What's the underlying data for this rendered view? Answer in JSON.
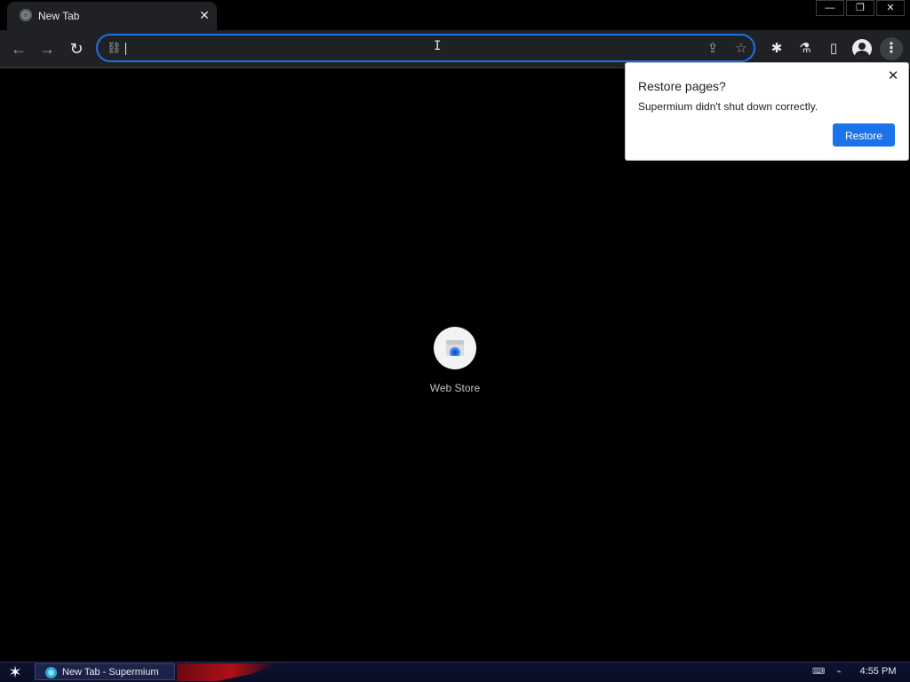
{
  "tab": {
    "title": "New Tab",
    "close_glyph": "✕",
    "favicon": "globe-icon"
  },
  "window_controls": {
    "minimize_glyph": "—",
    "restore_glyph": "❐",
    "close_glyph": "✕"
  },
  "toolbar": {
    "back_glyph": "←",
    "forward_glyph": "→",
    "reload_glyph": "↻",
    "share_glyph": "⇪",
    "bookmark_glyph": "☆",
    "extensions_glyph": "✱",
    "labs_glyph": "⚗",
    "side_panel_glyph": "▯",
    "menu_glyph": "⋮"
  },
  "omnibox": {
    "value": "",
    "placeholder": "",
    "site_info_glyph": "⛓"
  },
  "restore_popup": {
    "title": "Restore pages?",
    "message": "Supermium didn't shut down correctly.",
    "button_label": "Restore",
    "close_glyph": "✕"
  },
  "shortcuts": [
    {
      "label": "Web Store",
      "icon": "web-store-icon"
    }
  ],
  "taskbar": {
    "start_glyph": "✶",
    "task_label": "New Tab - Supermium",
    "keyboard_glyph": "⌨",
    "network_glyph": "⌁",
    "clock": "4:55 PM"
  },
  "colors": {
    "accent": "#1a73e8",
    "toolbar_bg": "#202124",
    "page_bg": "#000000",
    "taskbar_bg": "#0e1230"
  }
}
